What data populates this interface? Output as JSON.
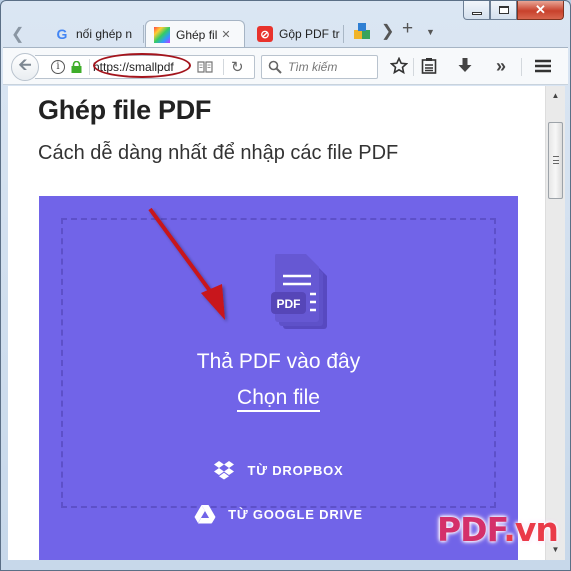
{
  "browser": {
    "tabs": [
      {
        "label": "nối ghép n",
        "favicon": "google-icon",
        "active": false
      },
      {
        "label": "Ghép fil",
        "favicon": "smallpdf-icon",
        "active": true
      },
      {
        "label": "Gộp PDF tr",
        "favicon": "pdf-red-icon",
        "active": false
      }
    ],
    "tab_close_glyph": "✕",
    "new_tab_glyph": "+",
    "url": "https://smallpdf",
    "search_placeholder": "Tìm kiếm",
    "window_close_glyph": "✕"
  },
  "page": {
    "title": "Ghép file PDF",
    "subtitle": "Cách dễ dàng nhất để nhập các file PDF",
    "file_icon_label": "PDF",
    "drop_text": "Thả PDF vào đây",
    "choose_file": "Chọn file",
    "dropbox_option": "TỪ DROPBOX",
    "gdrive_option": "TỪ GOOGLE DRIVE",
    "accent_color": "#7164e8"
  },
  "watermark": {
    "part1": "PDF",
    "part2": ".vn"
  }
}
